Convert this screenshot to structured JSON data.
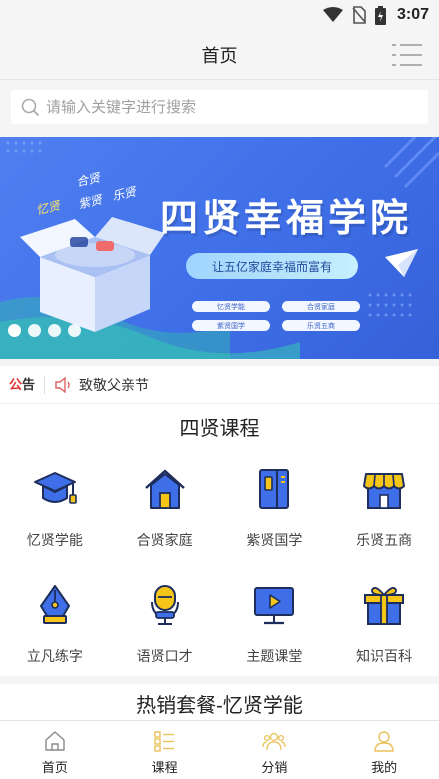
{
  "status_bar": {
    "time": "3:07"
  },
  "header": {
    "title": "首页"
  },
  "search": {
    "placeholder": "请输入关键字进行搜索"
  },
  "banner": {
    "title": "四贤幸福学院",
    "subtitle": "让五亿家庭幸福而富有",
    "chips": [
      "忆贤学能",
      "合贤家庭",
      "紫贤国学",
      "乐贤五商"
    ],
    "tags": [
      "忆贤",
      "合贤",
      "紫贤",
      "乐贤"
    ],
    "slide_count": 4,
    "active_slide": 1
  },
  "notice": {
    "label_red": "公",
    "label_dark": "告",
    "text": "致敬父亲节"
  },
  "courses": {
    "title": "四贤课程",
    "items": [
      {
        "label": "忆贤学能",
        "icon": "graduation-cap-icon"
      },
      {
        "label": "合贤家庭",
        "icon": "house-icon"
      },
      {
        "label": "紫贤国学",
        "icon": "book-icon"
      },
      {
        "label": "乐贤五商",
        "icon": "storefront-icon"
      },
      {
        "label": "立凡练字",
        "icon": "pen-nib-icon"
      },
      {
        "label": "语贤口才",
        "icon": "microphone-icon"
      },
      {
        "label": "主题课堂",
        "icon": "video-monitor-icon"
      },
      {
        "label": "知识百科",
        "icon": "gift-box-icon"
      }
    ]
  },
  "hot_section": {
    "title": "热销套餐-忆贤学能"
  },
  "tabbar": {
    "items": [
      {
        "label": "首页",
        "icon": "home-icon"
      },
      {
        "label": "课程",
        "icon": "course-list-icon"
      },
      {
        "label": "分销",
        "icon": "people-icon"
      },
      {
        "label": "我的",
        "icon": "person-icon"
      }
    ]
  },
  "colors": {
    "accent": "#f5c518",
    "icon_blue": "#3f6fe8",
    "notice_red": "#e03131",
    "banner_blue": "#4f7ff0"
  }
}
